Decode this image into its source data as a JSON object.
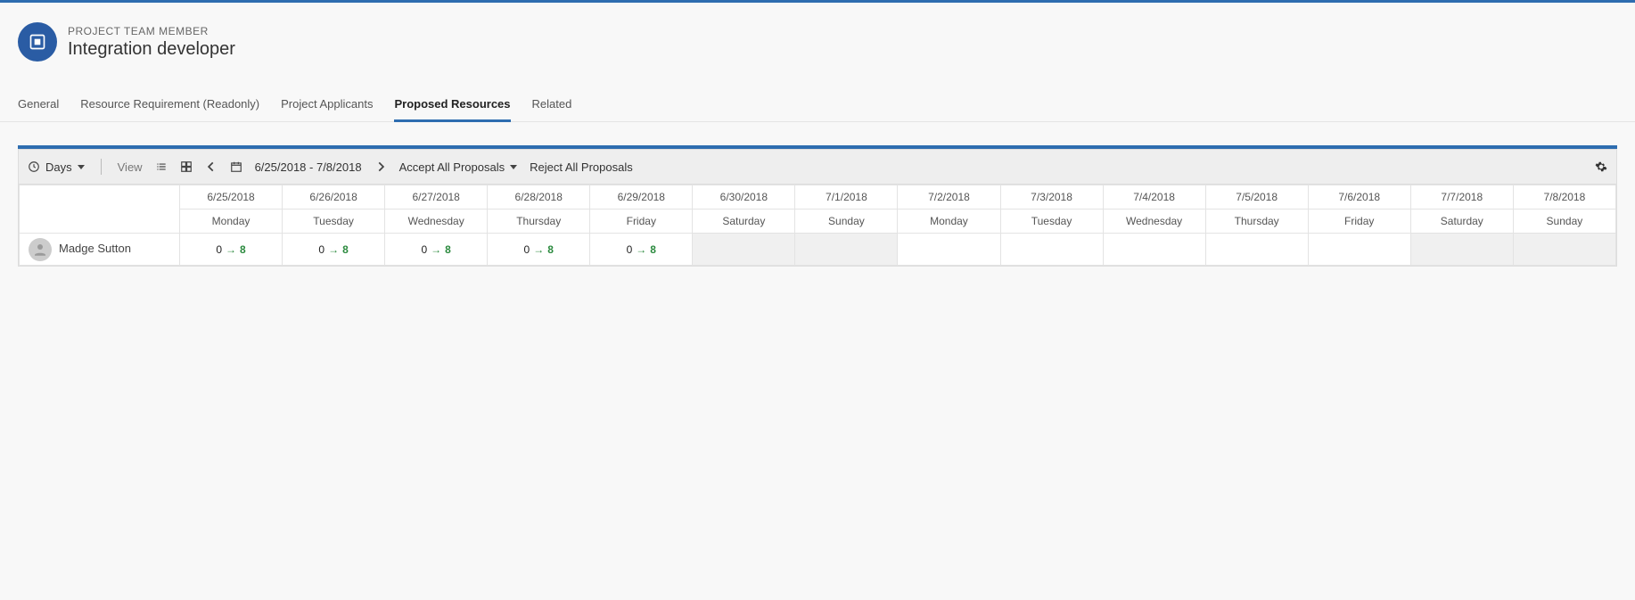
{
  "header": {
    "breadcrumb": "PROJECT TEAM MEMBER",
    "title": "Integration developer"
  },
  "tabs": [
    {
      "label": "General",
      "active": false
    },
    {
      "label": "Resource Requirement (Readonly)",
      "active": false
    },
    {
      "label": "Project Applicants",
      "active": false
    },
    {
      "label": "Proposed Resources",
      "active": true
    },
    {
      "label": "Related",
      "active": false
    }
  ],
  "toolbar": {
    "granularity": "Days",
    "view_label": "View",
    "date_range": "6/25/2018 - 7/8/2018",
    "accept_all": "Accept All Proposals",
    "reject_all": "Reject All Proposals"
  },
  "columns": [
    {
      "date": "6/25/2018",
      "day": "Monday"
    },
    {
      "date": "6/26/2018",
      "day": "Tuesday"
    },
    {
      "date": "6/27/2018",
      "day": "Wednesday"
    },
    {
      "date": "6/28/2018",
      "day": "Thursday"
    },
    {
      "date": "6/29/2018",
      "day": "Friday"
    },
    {
      "date": "6/30/2018",
      "day": "Saturday"
    },
    {
      "date": "7/1/2018",
      "day": "Sunday"
    },
    {
      "date": "7/2/2018",
      "day": "Monday"
    },
    {
      "date": "7/3/2018",
      "day": "Tuesday"
    },
    {
      "date": "7/4/2018",
      "day": "Wednesday"
    },
    {
      "date": "7/5/2018",
      "day": "Thursday"
    },
    {
      "date": "7/6/2018",
      "day": "Friday"
    },
    {
      "date": "7/7/2018",
      "day": "Saturday"
    },
    {
      "date": "7/8/2018",
      "day": "Sunday"
    }
  ],
  "rows": [
    {
      "name": "Madge Sutton",
      "cells": [
        {
          "from": "0",
          "to": "8",
          "disabled": false
        },
        {
          "from": "0",
          "to": "8",
          "disabled": false
        },
        {
          "from": "0",
          "to": "8",
          "disabled": false
        },
        {
          "from": "0",
          "to": "8",
          "disabled": false
        },
        {
          "from": "0",
          "to": "8",
          "disabled": false
        },
        {
          "from": null,
          "to": null,
          "disabled": true
        },
        {
          "from": null,
          "to": null,
          "disabled": true
        },
        {
          "from": null,
          "to": null,
          "disabled": false
        },
        {
          "from": null,
          "to": null,
          "disabled": false
        },
        {
          "from": null,
          "to": null,
          "disabled": false
        },
        {
          "from": null,
          "to": null,
          "disabled": false
        },
        {
          "from": null,
          "to": null,
          "disabled": false
        },
        {
          "from": null,
          "to": null,
          "disabled": true
        },
        {
          "from": null,
          "to": null,
          "disabled": true
        }
      ]
    }
  ]
}
